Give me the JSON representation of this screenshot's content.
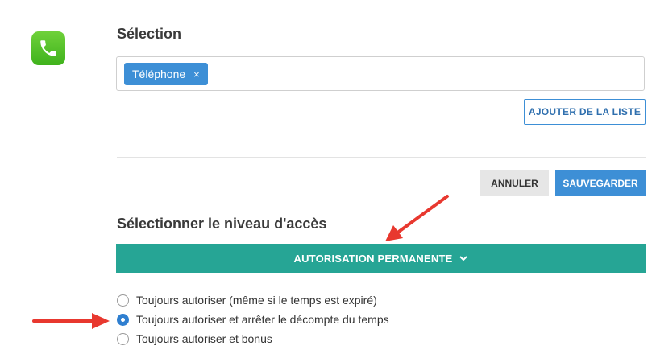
{
  "app": {
    "icon": "phone-icon",
    "accent_color": "#4cbf28"
  },
  "selection": {
    "title": "Sélection",
    "tags": [
      {
        "label": "Téléphone",
        "remove_symbol": "×"
      }
    ],
    "add_from_list_label": "AJOUTER DE LA LISTE"
  },
  "actions": {
    "cancel_label": "ANNULER",
    "save_label": "SAUVEGARDER"
  },
  "access": {
    "title": "Sélectionner le niveau d'accès",
    "dropdown_label": "AUTORISATION PERMANENTE",
    "dropdown_color": "#26a595",
    "options": [
      {
        "label": "Toujours autoriser (même si le temps est expiré)",
        "selected": false
      },
      {
        "label": "Toujours autoriser et arrêter le décompte du temps",
        "selected": true
      },
      {
        "label": "Toujours autoriser et bonus",
        "selected": false
      }
    ]
  },
  "annotations": {
    "arrow_color": "#e8382f"
  }
}
